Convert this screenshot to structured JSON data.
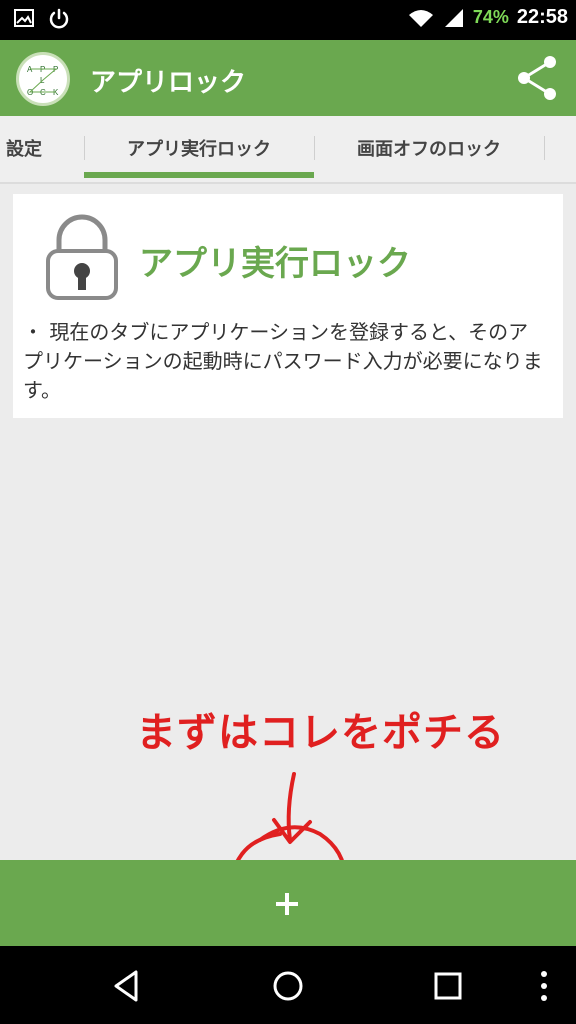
{
  "status_bar": {
    "battery": "74%",
    "time": "22:58",
    "icons": [
      "image-icon",
      "power-icon",
      "wifi-icon",
      "signal-icon",
      "battery-icon"
    ]
  },
  "app_bar": {
    "title": "アプリロック",
    "logo_text": [
      "A",
      "P",
      "P",
      "L",
      "O",
      "C",
      "K"
    ],
    "share_icon": "share-icon"
  },
  "tabs": [
    {
      "label": "設定"
    },
    {
      "label": "アプリ実行ロック",
      "active": true
    },
    {
      "label": "画面オフのロック"
    }
  ],
  "card": {
    "title": "アプリ実行ロック",
    "description": "・ 現在のタブにアプリケーションを登録すると、そのアプリケーションの起動時にパスワード入力が必要になります。",
    "icon": "lock-icon"
  },
  "annotation": {
    "text": "まずはコレをポチる"
  },
  "bottom_bar": {
    "add_label": "+"
  },
  "nav_bar": {
    "icons": [
      "back-icon",
      "home-icon",
      "recents-icon",
      "menu-icon"
    ]
  },
  "colors": {
    "accent": "#6aa84f",
    "annotation": "#e02020"
  }
}
